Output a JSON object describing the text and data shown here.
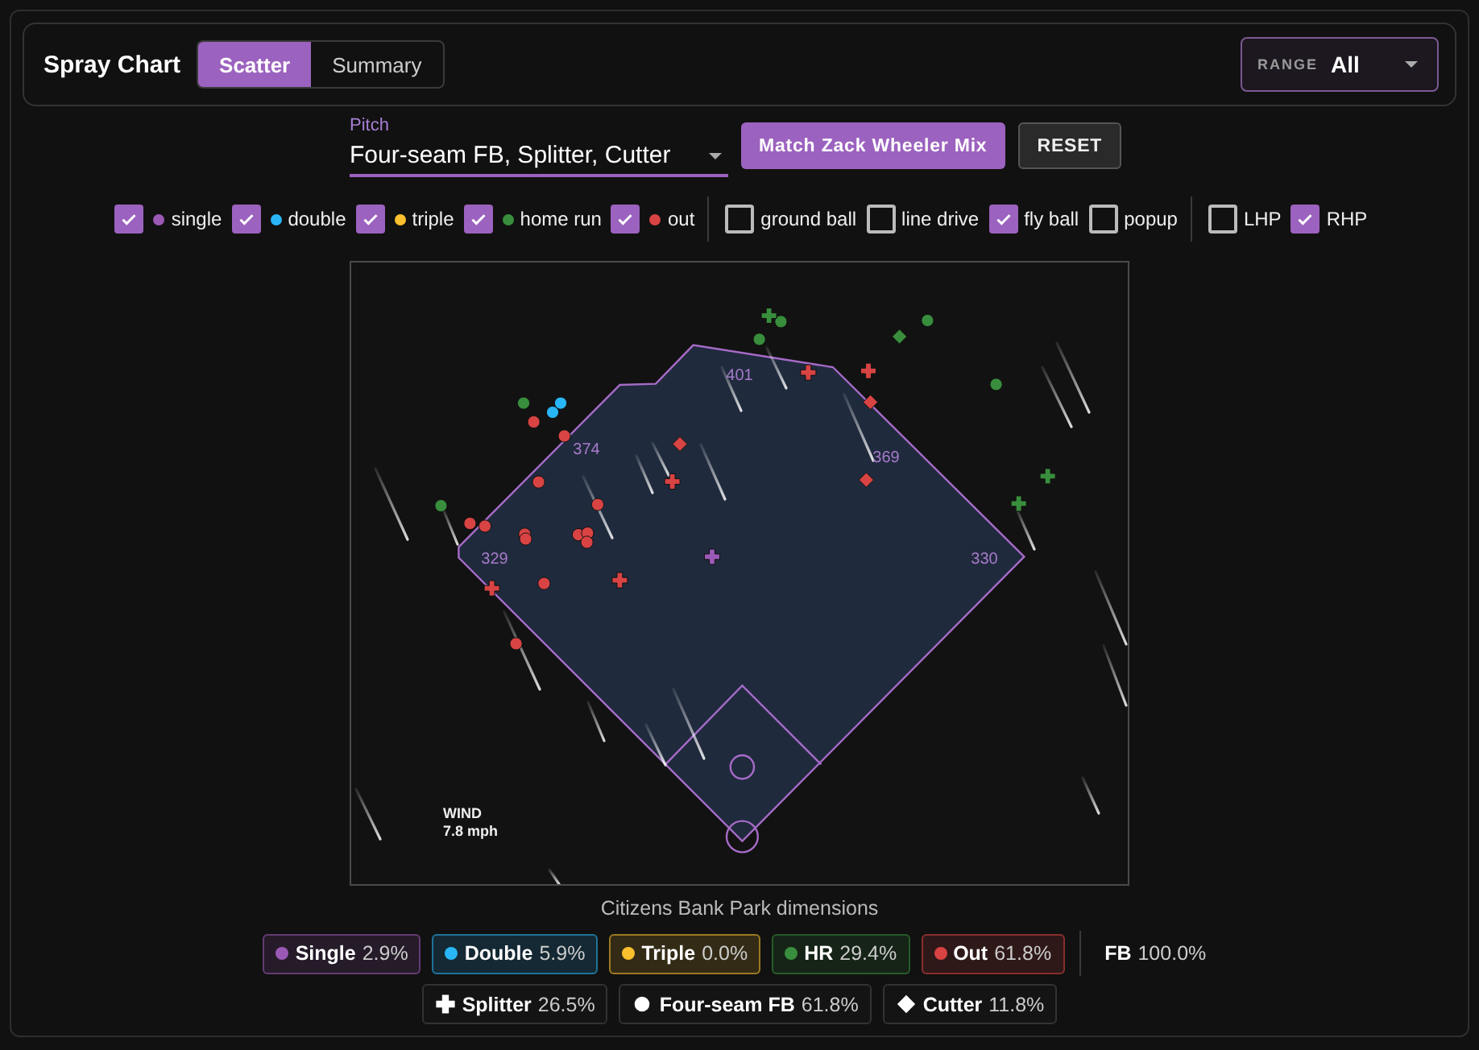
{
  "header": {
    "title": "Spray Chart",
    "view_tabs": [
      {
        "label": "Scatter",
        "selected": true
      },
      {
        "label": "Summary",
        "selected": false
      }
    ],
    "range": {
      "label": "RANGE",
      "value": "All"
    }
  },
  "pitch_select": {
    "label": "Pitch",
    "value": "Four-seam FB, Splitter, Cutter"
  },
  "buttons": [
    {
      "label": "Match Zack Wheeler Mix",
      "kind": "primary"
    },
    {
      "label": "RESET",
      "kind": "secondary"
    }
  ],
  "filter_groups": [
    [
      {
        "label": "single",
        "checked": true,
        "color": "#9b59b6"
      },
      {
        "label": "double",
        "checked": true,
        "color": "#29b6f6"
      },
      {
        "label": "triple",
        "checked": true,
        "color": "#fbc02d"
      },
      {
        "label": "home run",
        "checked": true,
        "color": "#388e3c"
      },
      {
        "label": "out",
        "checked": true,
        "color": "#d84343"
      }
    ],
    [
      {
        "label": "ground ball",
        "checked": false
      },
      {
        "label": "line drive",
        "checked": false
      },
      {
        "label": "fly ball",
        "checked": true
      },
      {
        "label": "popup",
        "checked": false
      }
    ],
    [
      {
        "label": "LHP",
        "checked": false
      },
      {
        "label": "RHP",
        "checked": true
      }
    ]
  ],
  "chart": {
    "distances": [
      "401",
      "374",
      "369",
      "329",
      "330"
    ],
    "wind": {
      "label": "WIND",
      "value": "7.8 mph"
    },
    "caption": "Citizens Bank Park dimensions"
  },
  "outcome_legend": [
    {
      "label": "Single",
      "value": "2.9%",
      "color": "#9b59b6"
    },
    {
      "label": "Double",
      "value": "5.9%",
      "color": "#29b6f6"
    },
    {
      "label": "Triple",
      "value": "0.0%",
      "color": "#fbc02d"
    },
    {
      "label": "HR",
      "value": "29.4%",
      "color": "#388e3c"
    },
    {
      "label": "Out",
      "value": "61.8%",
      "color": "#d84343"
    }
  ],
  "pitch_total": {
    "label": "FB",
    "value": "100.0%"
  },
  "pitch_legend": [
    {
      "label": "Splitter",
      "value": "26.5%",
      "kind": "cross"
    },
    {
      "label": "Four-seam FB",
      "value": "61.8%",
      "kind": "circle"
    },
    {
      "label": "Cutter",
      "value": "11.8%",
      "kind": "diamond"
    }
  ]
}
